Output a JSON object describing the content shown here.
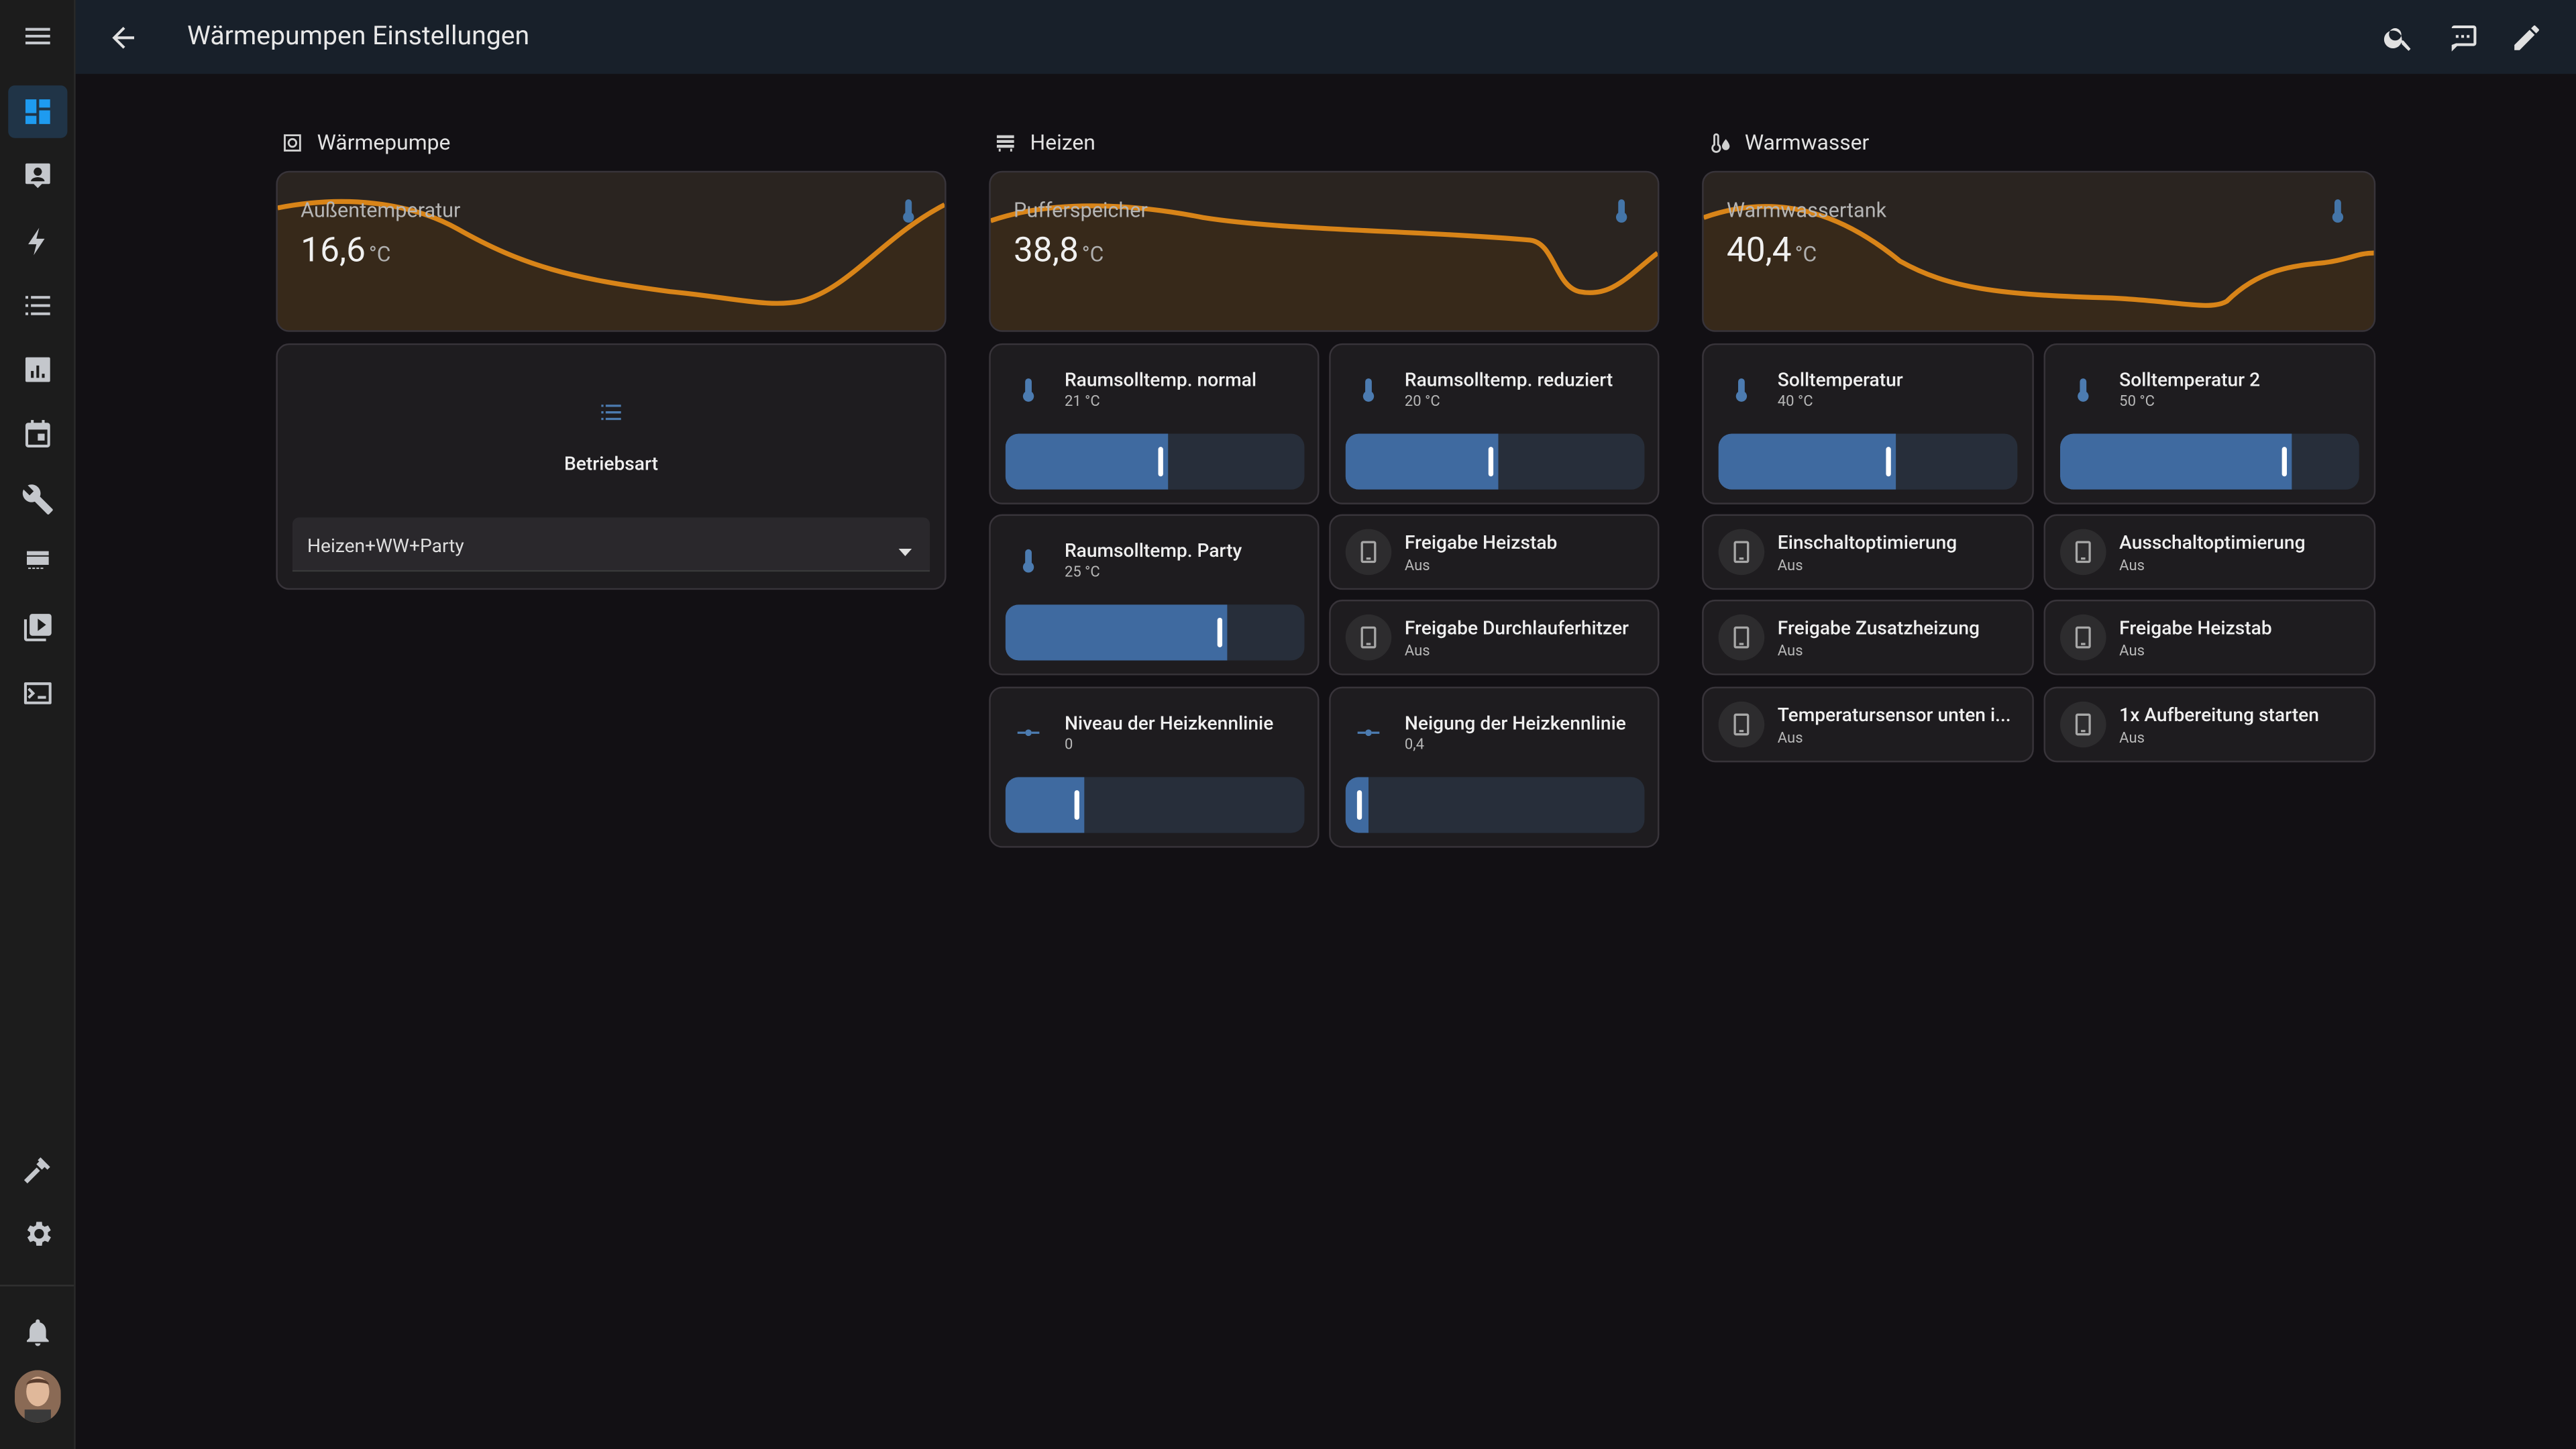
{
  "header": {
    "title": "Wärmepumpen Einstellungen"
  },
  "sections": {
    "waermepumpe": {
      "title": "Wärmepumpe"
    },
    "heizen": {
      "title": "Heizen"
    },
    "warmwasser": {
      "title": "Warmwasser"
    }
  },
  "graphs": {
    "aussen": {
      "name": "Außentemperatur",
      "value": "16,6",
      "unit": "°C"
    },
    "puffer": {
      "name": "Pufferspeicher",
      "value": "38,8",
      "unit": "°C"
    },
    "tank": {
      "name": "Warmwassertank",
      "value": "40,4",
      "unit": "°C"
    }
  },
  "betriebsart": {
    "label": "Betriebsart",
    "value": "Heizen+WW+Party"
  },
  "heizen": {
    "normal": {
      "name": "Raumsolltemp. normal",
      "state": "21 °C",
      "level": 0.52
    },
    "reduziert": {
      "name": "Raumsolltemp. reduziert",
      "state": "20 °C",
      "level": 0.49
    },
    "party": {
      "name": "Raumsolltemp. Party",
      "state": "25 °C",
      "level": 0.72
    },
    "heizstab": {
      "name": "Freigabe Heizstab",
      "state": "Aus"
    },
    "durchlauf": {
      "name": "Freigabe Durchlauferhitzer",
      "state": "Aus"
    },
    "niveau": {
      "name": "Niveau der Heizkennlinie",
      "state": "0",
      "level": 0.24
    },
    "neigung": {
      "name": "Neigung der Heizkennlinie",
      "state": "0,4",
      "level": 0.05
    }
  },
  "warmwasser": {
    "soll": {
      "name": "Solltemperatur",
      "state": "40 °C",
      "level": 0.57
    },
    "soll2": {
      "name": "Solltemperatur 2",
      "state": "50 °C",
      "level": 0.75
    },
    "einschalt": {
      "name": "Einschaltoptimierung",
      "state": "Aus"
    },
    "ausschalt": {
      "name": "Ausschaltoptimierung",
      "state": "Aus"
    },
    "zusatz": {
      "name": "Freigabe Zusatzheizung",
      "state": "Aus"
    },
    "heizstab": {
      "name": "Freigabe Heizstab",
      "state": "Aus"
    },
    "sensor": {
      "name": "Temperatursensor unten i...",
      "state": "Aus"
    },
    "aufbereitung": {
      "name": "1x Aufbereitung starten",
      "state": "Aus"
    }
  },
  "colors": {
    "accent": "#1e9bf0",
    "graph_line": "#d88418",
    "slider_fill": "#3f6aa0",
    "thermo": "#4475a8"
  },
  "icons": {
    "sidebar": [
      "menu-icon",
      "dashboard-icon",
      "account-box-icon",
      "energy-icon",
      "logbook-icon",
      "history-icon",
      "calendar-icon",
      "tools-icon",
      "hacs-icon",
      "media-icon",
      "terminal-icon",
      "developer-hammer-icon",
      "settings-icon",
      "bell-icon"
    ],
    "header": [
      "back-arrow-icon",
      "search-icon",
      "assist-icon",
      "edit-icon"
    ]
  }
}
